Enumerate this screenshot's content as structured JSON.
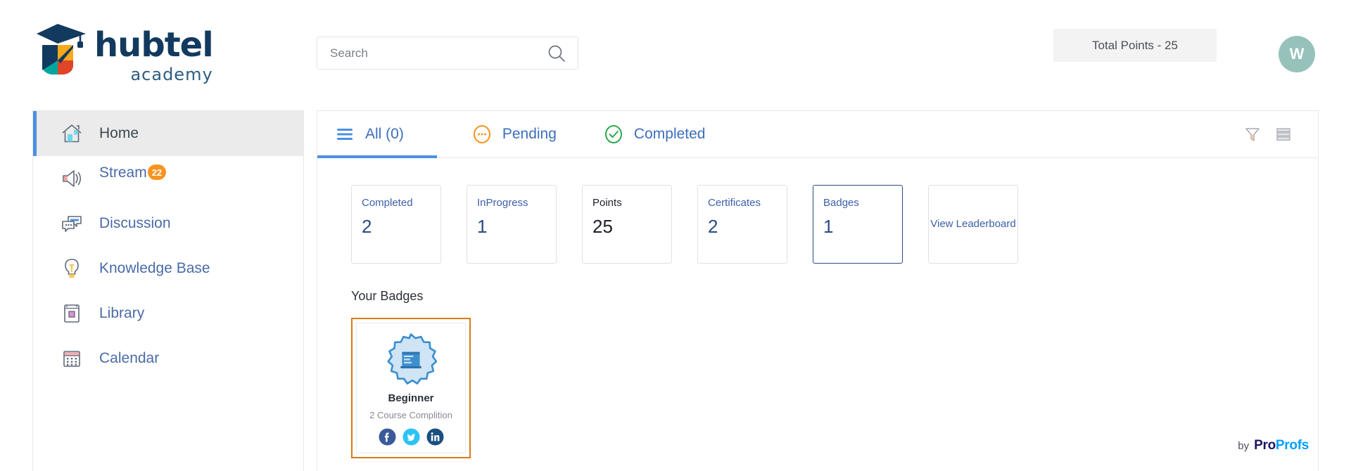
{
  "brand": {
    "logo_name": "hubtel",
    "logo_sub": "academy",
    "logo_icon": "graduation-cap-logo-icon"
  },
  "search": {
    "placeholder": "Search",
    "value": "",
    "icon": "search-icon"
  },
  "header": {
    "total_points_label": "Total Points - 25",
    "avatar_initial": "W",
    "avatar_color": "#97c2bb"
  },
  "sidebar": {
    "items": [
      {
        "label": "Home",
        "icon": "home-icon",
        "active": true,
        "badge": null
      },
      {
        "label": "Stream",
        "icon": "megaphone-icon",
        "active": false,
        "badge": "22"
      },
      {
        "label": "Discussion",
        "icon": "chat-bubbles-icon",
        "active": false,
        "badge": null
      },
      {
        "label": "Knowledge Base",
        "icon": "lightbulb-icon",
        "active": false,
        "badge": null
      },
      {
        "label": "Library",
        "icon": "book-icon",
        "active": false,
        "badge": null
      },
      {
        "label": "Calendar",
        "icon": "calendar-icon",
        "active": false,
        "badge": null
      }
    ]
  },
  "tabs": [
    {
      "label": "All (0)",
      "icon": "hamburger-list-icon",
      "active": true
    },
    {
      "label": "Pending",
      "icon": "pending-dots-circle-icon",
      "active": false
    },
    {
      "label": "Completed",
      "icon": "check-circle-icon",
      "active": false
    }
  ],
  "tab_tools": [
    {
      "name": "filter-funnel-icon"
    },
    {
      "name": "list-view-icon"
    }
  ],
  "cards": [
    {
      "label": "Completed",
      "value": "2",
      "selected": false,
      "style": "blue"
    },
    {
      "label": "InProgress",
      "value": "1",
      "selected": false,
      "style": "blue"
    },
    {
      "label": "Points",
      "value": "25",
      "selected": false,
      "style": "dark"
    },
    {
      "label": "Certificates",
      "value": "2",
      "selected": false,
      "style": "blue"
    },
    {
      "label": "Badges",
      "value": "1",
      "selected": true,
      "style": "blue"
    },
    {
      "label": "View Leaderboard",
      "value": "",
      "selected": false,
      "style": "center"
    }
  ],
  "badges_section": {
    "title": "Your Badges",
    "badge": {
      "name": "Beginner",
      "description": "2 Course Complition",
      "emblem_icon": "certificate-badge-icon",
      "border_color": "#da7b13",
      "socials": [
        {
          "name": "facebook-share-icon",
          "color": "#3b5a9a"
        },
        {
          "name": "twitter-share-icon",
          "color": "#2cc3f5"
        },
        {
          "name": "linkedin-share-icon",
          "color": "#1c4e80"
        }
      ]
    }
  },
  "footer": {
    "by": "by",
    "brand_part1": "Pro",
    "brand_part2": "Profs"
  },
  "colors": {
    "accent_blue": "#4a90e2",
    "link_blue": "#3c6ebf",
    "orange": "#f7941e",
    "badge_border": "#da7b13"
  }
}
